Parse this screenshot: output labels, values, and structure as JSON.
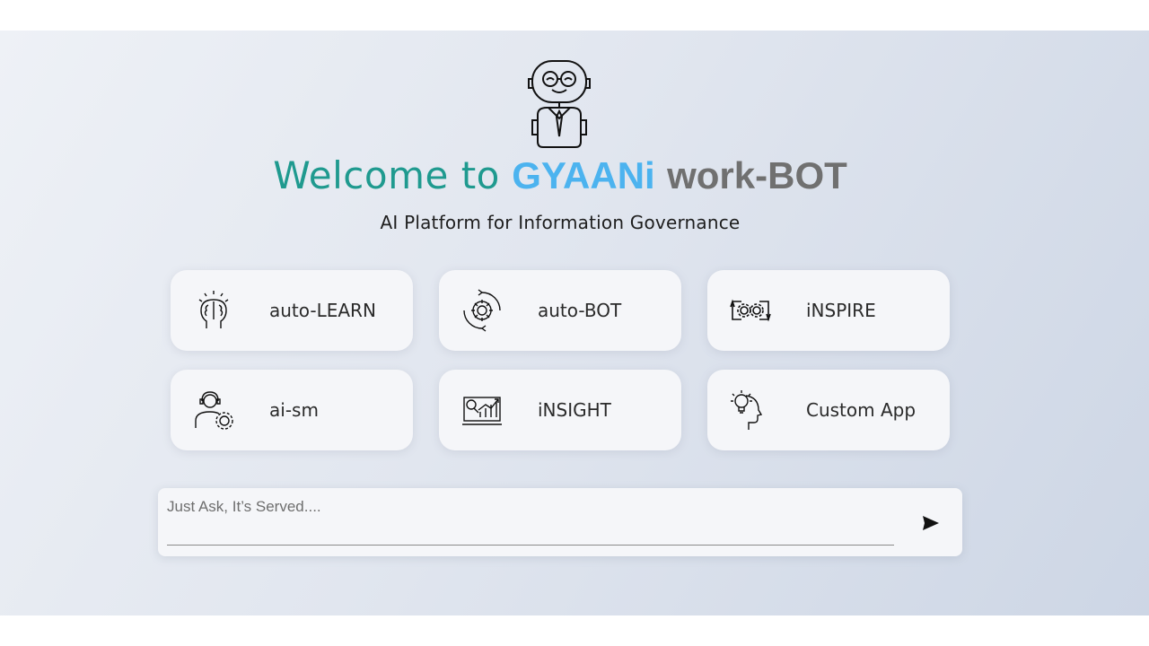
{
  "header": {
    "title_prefix": "Welcome to",
    "title_brand": "GYAANi",
    "title_suffix": "work-BOT",
    "subtitle": "AI Platform for Information Governance"
  },
  "tiles": [
    {
      "label": "auto-LEARN",
      "icon": "brain-head-icon"
    },
    {
      "label": "auto-BOT",
      "icon": "gear-cycle-icon"
    },
    {
      "label": "iNSPIRE",
      "icon": "gears-icon"
    },
    {
      "label": "ai-sm",
      "icon": "support-agent-icon"
    },
    {
      "label": "iNSIGHT",
      "icon": "analytics-icon"
    },
    {
      "label": "Custom App",
      "icon": "idea-head-icon"
    }
  ],
  "ask": {
    "placeholder": "Just Ask, It’s Served....",
    "value": ""
  },
  "colors": {
    "welcome": "#1f9a8f",
    "brand": "#4cb3ef",
    "bot": "#707070"
  }
}
